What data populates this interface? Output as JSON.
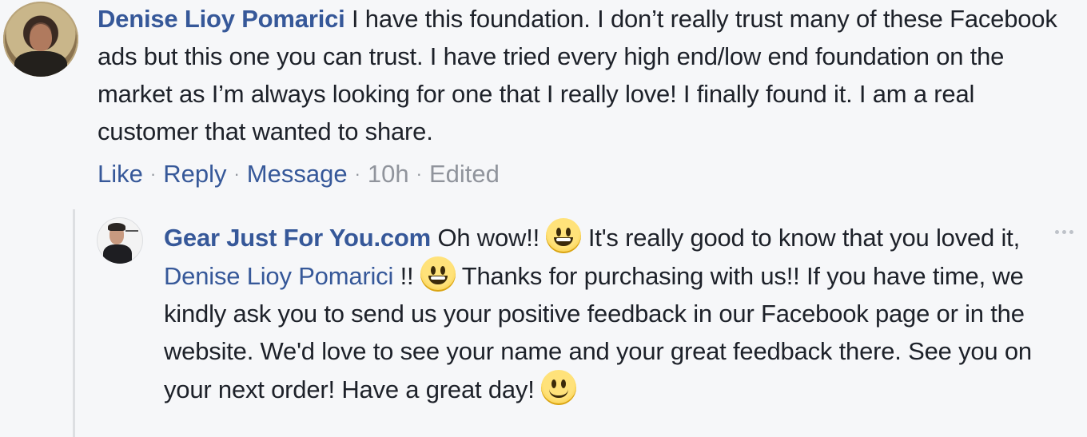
{
  "comment": {
    "author": "Denise Lioy Pomarici",
    "text": "I have this foundation. I don’t really trust many of these Facebook ads but this one you can trust. I have tried every high end/low end foundation on the market as I’m always looking for one that I really love! I finally found it. I am a real customer that wanted to share.",
    "actions": {
      "like": "Like",
      "reply": "Reply",
      "message": "Message",
      "time": "10h",
      "edited": "Edited"
    }
  },
  "reply": {
    "author": "Gear Just For You.com",
    "part1": "Oh wow!!",
    "part2": "It's really good to know that you loved it,",
    "mention": "Denise Lioy Pomarici",
    "part3": "!!",
    "part4": "Thanks for purchasing with us!! If you have time, we kindly ask you to send us your positive feedback in our Facebook page or in the website. We'd love to see your name and your great feedback there. See you on your next order! Have a great day!",
    "emojis": [
      "grinning-emoji",
      "grinning-emoji",
      "slight-smile-emoji"
    ],
    "more_icon": "more-options-icon"
  },
  "colors": {
    "link": "#365899",
    "meta": "#90949c",
    "background": "#f6f7f9",
    "text": "#1d2129"
  }
}
